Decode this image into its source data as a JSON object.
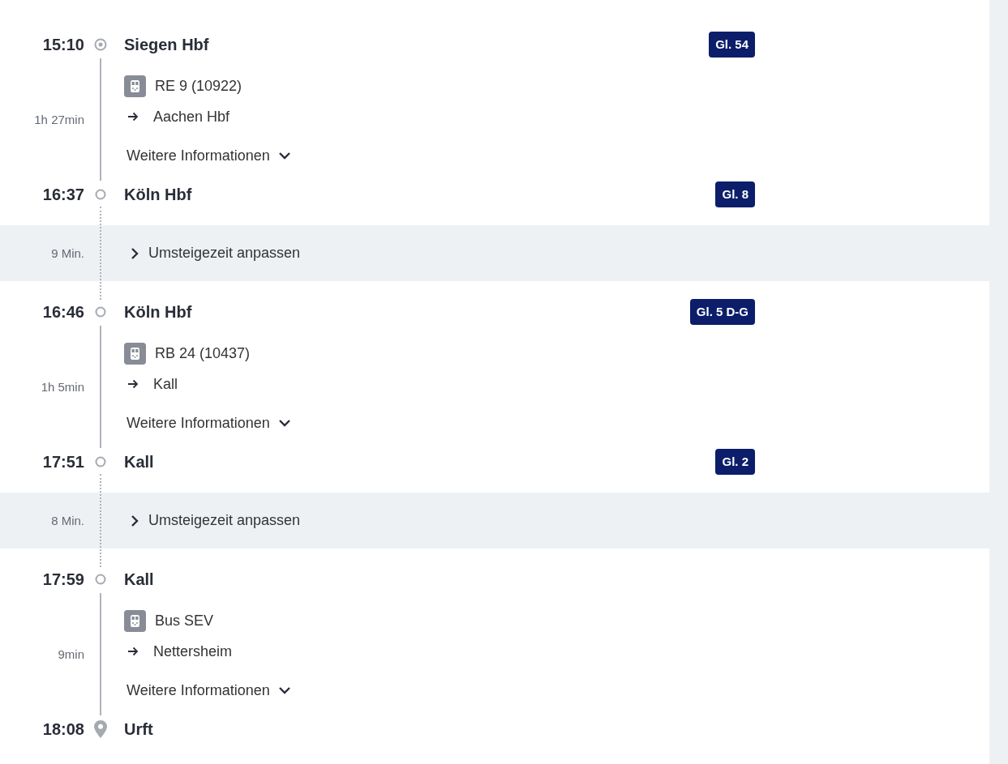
{
  "segments": [
    {
      "kind": "leg",
      "departure": {
        "time": "15:10",
        "station": "Siegen Hbf",
        "platform": "Gl. 54",
        "kind": "origin"
      },
      "vehicle": "RE 9 (10922)",
      "direction": "Aachen Hbf",
      "duration": "1h 27min",
      "more_info": "Weitere Informationen",
      "arrival": {
        "time": "16:37",
        "station": "Köln Hbf",
        "platform": "Gl. 8",
        "kind": "stop"
      }
    },
    {
      "kind": "transfer",
      "duration": "9 Min.",
      "action": "Umsteigezeit anpassen"
    },
    {
      "kind": "leg",
      "departure": {
        "time": "16:46",
        "station": "Köln Hbf",
        "platform": "Gl. 5 D-G",
        "kind": "stop"
      },
      "vehicle": "RB 24 (10437)",
      "direction": "Kall",
      "duration": "1h 5min",
      "more_info": "Weitere Informationen",
      "arrival": {
        "time": "17:51",
        "station": "Kall",
        "platform": "Gl. 2",
        "kind": "stop"
      }
    },
    {
      "kind": "transfer",
      "duration": "8 Min.",
      "action": "Umsteigezeit anpassen"
    },
    {
      "kind": "leg",
      "departure": {
        "time": "17:59",
        "station": "Kall",
        "kind": "stop"
      },
      "vehicle": "Bus SEV",
      "direction": "Nettersheim",
      "duration": "9min",
      "more_info": "Weitere Informationen",
      "arrival": {
        "time": "18:08",
        "station": "Urft",
        "kind": "destination"
      }
    }
  ]
}
